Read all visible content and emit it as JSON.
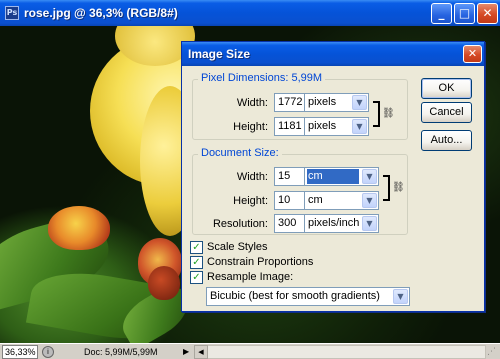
{
  "window": {
    "title": "rose.jpg @ 36,3% (RGB/8#)",
    "app_icon": "Ps",
    "minimize": "_",
    "maximize": "□",
    "close": "✕"
  },
  "status": {
    "zoom": "36,33%",
    "doc_info": "Doc: 5,99M/5,99M",
    "arrow": "▶",
    "scroll_left": "◀",
    "grip": "⋰"
  },
  "dialog": {
    "title": "Image Size",
    "close": "✕",
    "pixel_dimensions": {
      "legend": "Pixel Dimensions:  5,99M",
      "width_label": "Width:",
      "width_value": "1772",
      "width_unit": "pixels",
      "height_label": "Height:",
      "height_value": "1181",
      "height_unit": "pixels"
    },
    "document_size": {
      "legend": "Document Size:",
      "width_label": "Width:",
      "width_value": "15",
      "width_unit": "cm",
      "height_label": "Height:",
      "height_value": "10",
      "height_unit": "cm",
      "resolution_label": "Resolution:",
      "resolution_value": "300",
      "resolution_unit": "pixels/inch"
    },
    "options": {
      "scale_styles": "Scale Styles",
      "constrain_proportions": "Constrain Proportions",
      "resample_image": "Resample Image:",
      "resample_method": "Bicubic (best for smooth gradients)",
      "checkmark": "✓"
    },
    "buttons": {
      "ok": "OK",
      "cancel": "Cancel",
      "auto": "Auto..."
    },
    "dropdown_arrow": "▼",
    "link_icon": "🔗"
  },
  "colors": {
    "xp_blue": "#0553d8",
    "legend_blue": "#0046d5",
    "selection": "#316ac5"
  }
}
